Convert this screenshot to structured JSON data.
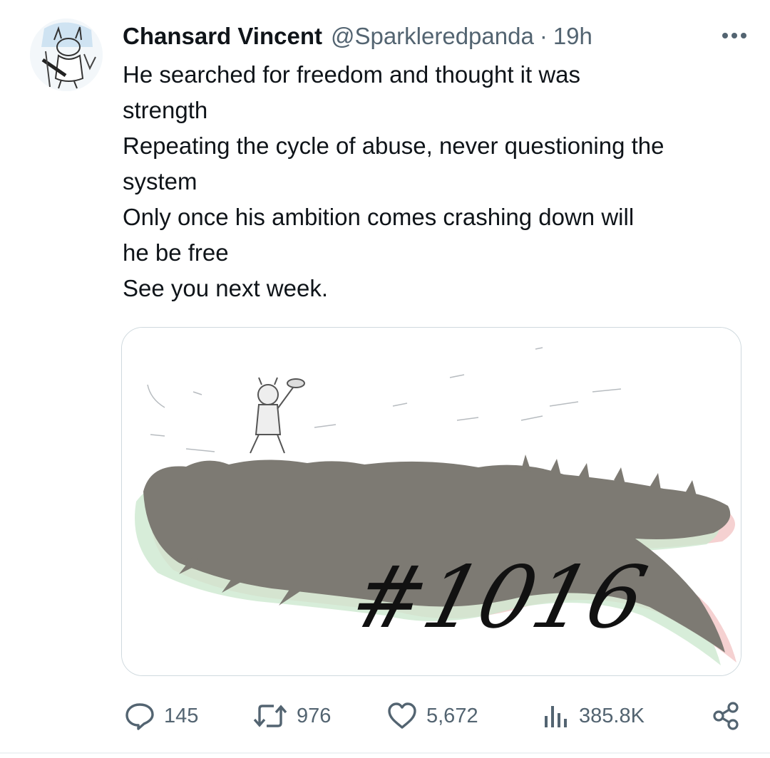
{
  "tweet": {
    "author_name": "Chansard Vincent",
    "handle": "@Sparkleredpanda",
    "separator": "·",
    "time": "19h",
    "text_lines": [
      "He searched for freedom and thought it was",
      "strength",
      "Repeating the cycle of abuse, never questioning the",
      "system",
      "Only once his ambition comes crashing down will",
      "he be free",
      "See you next week."
    ],
    "media": {
      "caption_art_text": "#1016"
    }
  },
  "actions": {
    "replies": "145",
    "retweets": "976",
    "likes": "5,672",
    "views": "385.8K"
  },
  "icons": {
    "more": "more-horizontal-icon",
    "reply": "reply-icon",
    "retweet": "retweet-icon",
    "like": "heart-icon",
    "views": "views-bar-chart-icon",
    "share": "share-icon"
  },
  "colors": {
    "text": "#0f1419",
    "secondary": "#536471",
    "border": "#cfd9de"
  }
}
